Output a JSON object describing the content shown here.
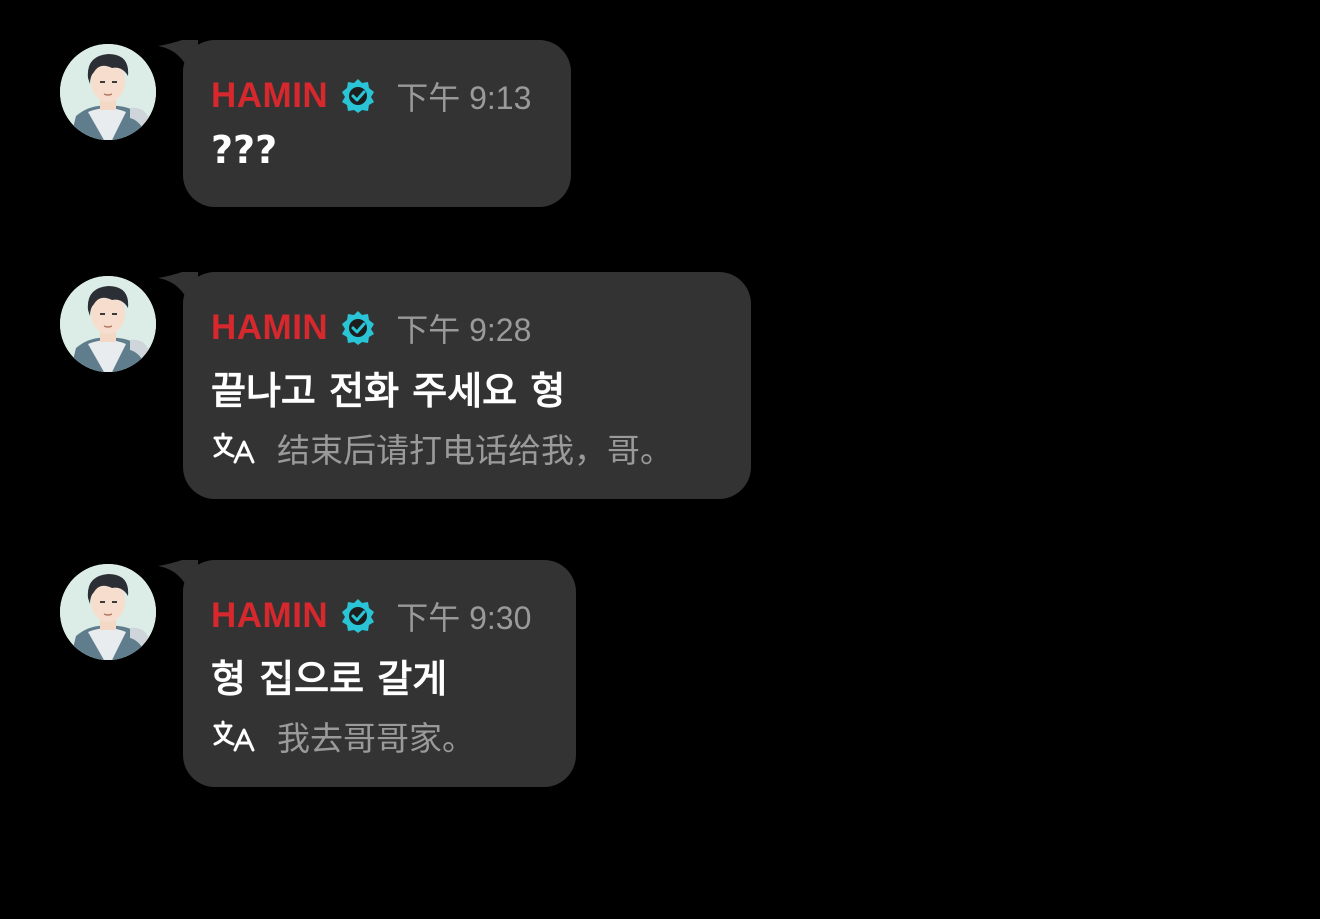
{
  "messages": [
    {
      "sender": "HAMIN",
      "time": "下午 9:13",
      "text": "???",
      "translation": "",
      "avatar": "avatar-profile-photo",
      "verified_icon": "verified-badge-icon"
    },
    {
      "sender": "HAMIN",
      "time": "下午 9:28",
      "text": "끝나고 전화 주세요 형",
      "translation": "结束后请打电话给我，哥。",
      "avatar": "avatar-profile-photo",
      "verified_icon": "verified-badge-icon",
      "translate_icon": "translate-icon"
    },
    {
      "sender": "HAMIN",
      "time": "下午 9:30",
      "text": "형 집으로 갈게",
      "translation": "我去哥哥家。",
      "avatar": "avatar-profile-photo",
      "verified_icon": "verified-badge-icon",
      "translate_icon": "translate-icon"
    }
  ],
  "colors": {
    "background": "#000000",
    "bubble": "#333333",
    "sender": "#d6282d",
    "verified": "#29c5d6",
    "secondary_text": "#9a9a9a",
    "primary_text": "#ffffff"
  }
}
